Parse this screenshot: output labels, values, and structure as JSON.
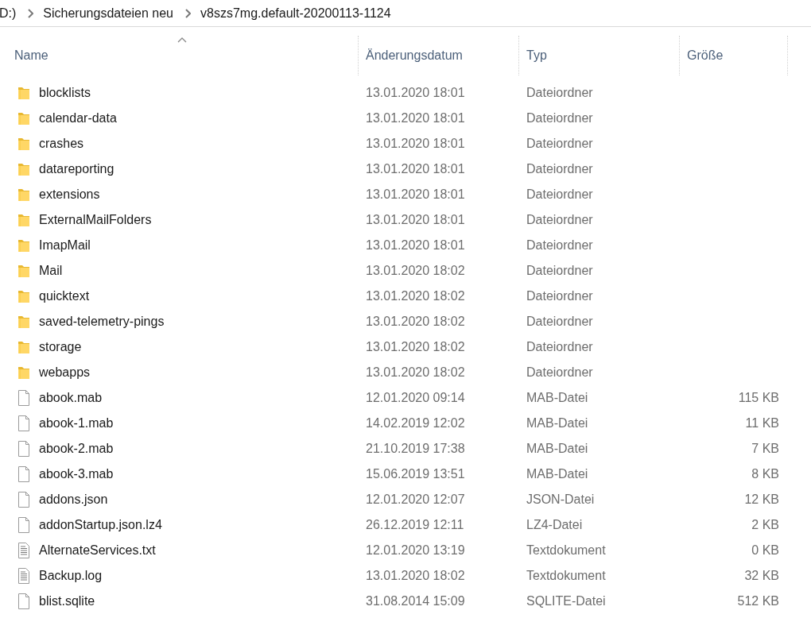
{
  "breadcrumb": [
    "D:)",
    "Sicherungsdateien neu",
    "v8szs7mg.default-20200113-1124"
  ],
  "table": {
    "columns": [
      {
        "label": "Name",
        "sorted": true
      },
      {
        "label": "Änderungsdatum",
        "sorted": false
      },
      {
        "label": "Typ",
        "sorted": false
      },
      {
        "label": "Größe",
        "sorted": false
      }
    ],
    "rows": [
      {
        "kind": "folder",
        "name": "blocklists",
        "date": "13.01.2020 18:01",
        "type": "Dateiordner"
      },
      {
        "kind": "folder",
        "name": "calendar-data",
        "date": "13.01.2020 18:01",
        "type": "Dateiordner"
      },
      {
        "kind": "folder",
        "name": "crashes",
        "date": "13.01.2020 18:01",
        "type": "Dateiordner"
      },
      {
        "kind": "folder",
        "name": "datareporting",
        "date": "13.01.2020 18:01",
        "type": "Dateiordner"
      },
      {
        "kind": "folder",
        "name": "extensions",
        "date": "13.01.2020 18:01",
        "type": "Dateiordner"
      },
      {
        "kind": "folder",
        "name": "ExternalMailFolders",
        "date": "13.01.2020 18:01",
        "type": "Dateiordner"
      },
      {
        "kind": "folder",
        "name": "ImapMail",
        "date": "13.01.2020 18:01",
        "type": "Dateiordner"
      },
      {
        "kind": "folder",
        "name": "Mail",
        "date": "13.01.2020 18:02",
        "type": "Dateiordner"
      },
      {
        "kind": "folder",
        "name": "quicktext",
        "date": "13.01.2020 18:02",
        "type": "Dateiordner"
      },
      {
        "kind": "folder",
        "name": "saved-telemetry-pings",
        "date": "13.01.2020 18:02",
        "type": "Dateiordner"
      },
      {
        "kind": "folder",
        "name": "storage",
        "date": "13.01.2020 18:02",
        "type": "Dateiordner"
      },
      {
        "kind": "folder",
        "name": "webapps",
        "date": "13.01.2020 18:02",
        "type": "Dateiordner"
      },
      {
        "kind": "file",
        "name": "abook.mab",
        "date": "12.01.2020 09:14",
        "type": "MAB-Datei",
        "size": "115 KB"
      },
      {
        "kind": "file",
        "name": "abook-1.mab",
        "date": "14.02.2019 12:02",
        "type": "MAB-Datei",
        "size": "11 KB"
      },
      {
        "kind": "file",
        "name": "abook-2.mab",
        "date": "21.10.2019 17:38",
        "type": "MAB-Datei",
        "size": "7 KB"
      },
      {
        "kind": "file",
        "name": "abook-3.mab",
        "date": "15.06.2019 13:51",
        "type": "MAB-Datei",
        "size": "8 KB"
      },
      {
        "kind": "file",
        "name": "addons.json",
        "date": "12.01.2020 12:07",
        "type": "JSON-Datei",
        "size": "12 KB"
      },
      {
        "kind": "file",
        "name": "addonStartup.json.lz4",
        "date": "26.12.2019 12:11",
        "type": "LZ4-Datei",
        "size": "2 KB"
      },
      {
        "kind": "text",
        "name": "AlternateServices.txt",
        "date": "12.01.2020 13:19",
        "type": "Textdokument",
        "size": "0 KB"
      },
      {
        "kind": "text",
        "name": "Backup.log",
        "date": "13.01.2020 18:02",
        "type": "Textdokument",
        "size": "32 KB"
      },
      {
        "kind": "file",
        "name": "blist.sqlite",
        "date": "31.08.2014 15:09",
        "type": "SQLITE-Datei",
        "size": "512 KB"
      }
    ]
  }
}
